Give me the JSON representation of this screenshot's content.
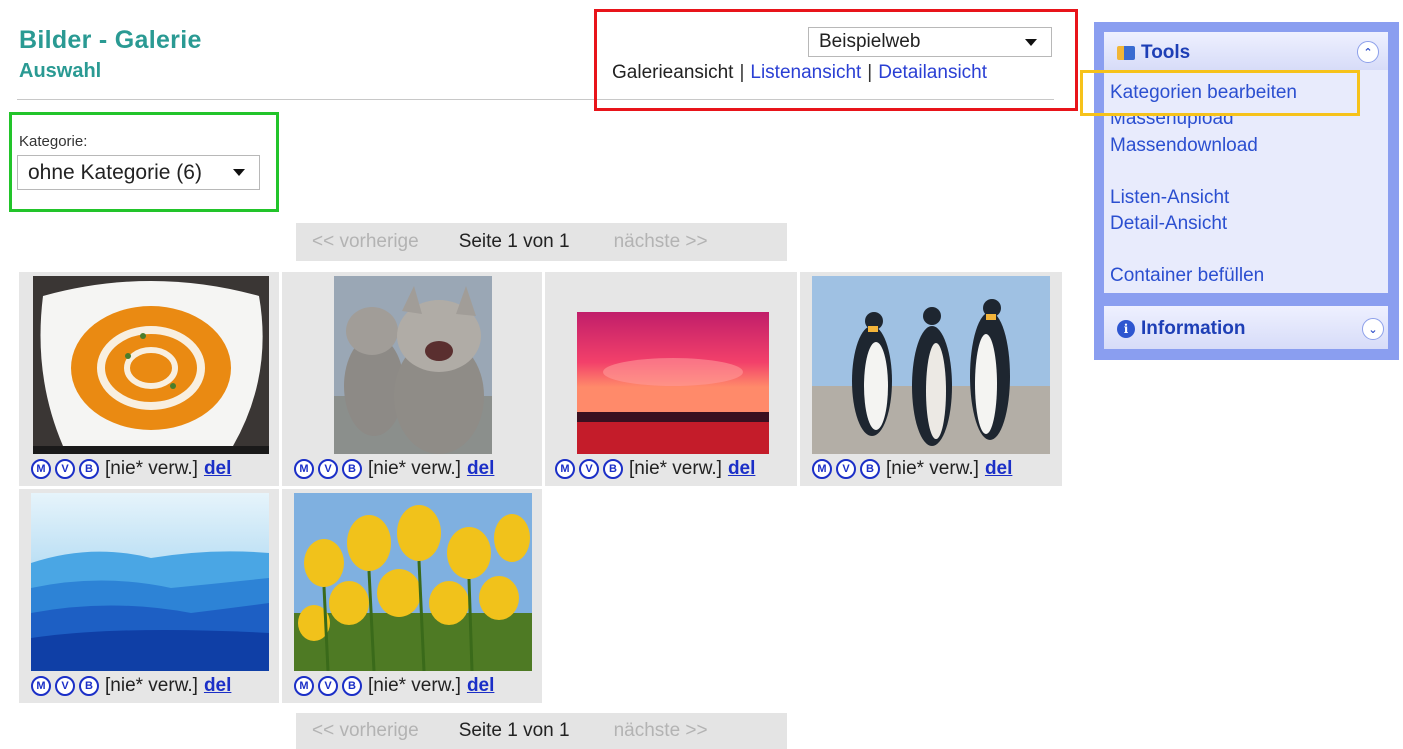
{
  "header": {
    "title": "Bilder - Galerie",
    "subtitle": "Auswahl"
  },
  "web_select": {
    "value": "Beispielweb"
  },
  "views": {
    "galerie": "Galerieansicht",
    "liste": "Listenansicht",
    "detail": "Detailansicht",
    "separator": "|"
  },
  "category": {
    "label": "Kategorie:",
    "value": "ohne Kategorie (6)"
  },
  "pager": {
    "prev": "<< vorherige",
    "page": "Seite 1 von 1",
    "next": "nächste >>"
  },
  "gallery": {
    "icons": [
      "M",
      "V",
      "B"
    ],
    "items": [
      {
        "usage": "[nie* verw.]",
        "del": "del",
        "image": "pumpkin-soup"
      },
      {
        "usage": "[nie* verw.]",
        "del": "del",
        "image": "laughing-kittens"
      },
      {
        "usage": "[nie* verw.]",
        "del": "del",
        "image": "red-sunset"
      },
      {
        "usage": "[nie* verw.]",
        "del": "del",
        "image": "penguins"
      },
      {
        "usage": "[nie* verw.]",
        "del": "del",
        "image": "blue-hills"
      },
      {
        "usage": "[nie* verw.]",
        "del": "del",
        "image": "yellow-tulips"
      }
    ]
  },
  "sidebar": {
    "tools_title": "Tools",
    "tools_links": [
      "Kategorien bearbeiten",
      "Massenupload",
      "Massendownload",
      "Listen-Ansicht",
      "Detail-Ansicht",
      "Container befüllen"
    ],
    "info_title": "Information"
  },
  "highlight_colors": {
    "red": "#e8141a",
    "green": "#22c42a",
    "orange": "#f6c21a"
  }
}
